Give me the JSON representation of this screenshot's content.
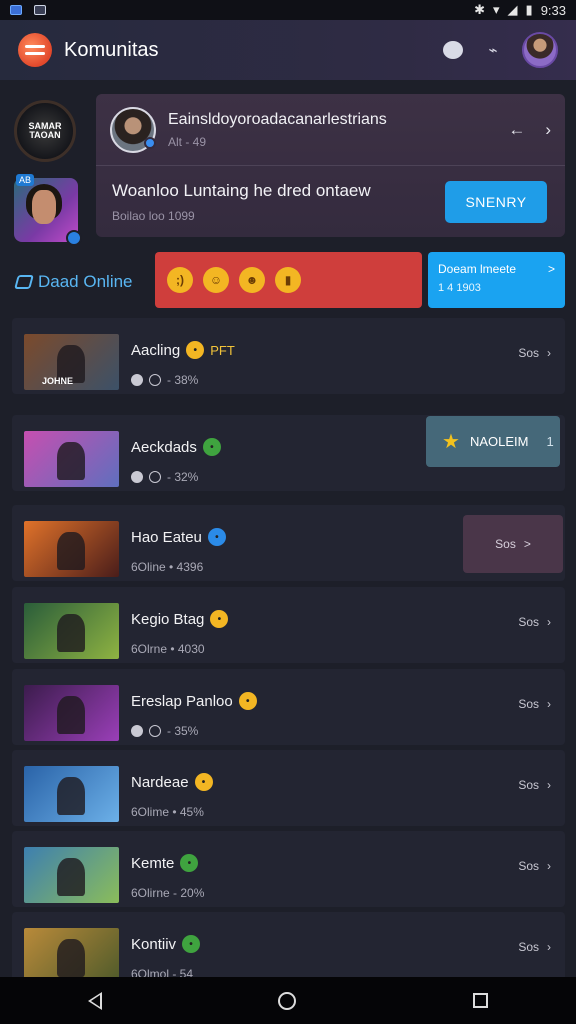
{
  "status_bar": {
    "time": "9:33"
  },
  "app_bar": {
    "title": "Komunitas"
  },
  "feature": {
    "name": "Eainsldoyoroadacanarlestrians",
    "sub": "Alt - 49",
    "message": "Woanloo Luntaing he dred ontaew",
    "message_sub": "Boilao loo 1099",
    "button": "SNENRY"
  },
  "left_avatars": {
    "top_label": "SAMAR TAOAN",
    "tag": "AB"
  },
  "online": {
    "label": "Daad Online"
  },
  "promo": {
    "title": "Doeam lmeete",
    "arrow": ">",
    "sub": "1 4 1903"
  },
  "list": [
    {
      "title": "Aacling",
      "badge": "PFT",
      "sub": "- 38%",
      "action": "Sos",
      "thumb": "JOHNE",
      "colors": [
        "#7b4a2c",
        "#3c5168"
      ],
      "emoji_color": "#f3b623"
    },
    {
      "title": "Aeckdads",
      "sub": "- 32%",
      "thumb": "",
      "colors": [
        "#c64fb0",
        "#5f6fbe"
      ],
      "emoji_color": "#3fa33f"
    },
    {
      "title": "Hao Eateu",
      "sub": "6Oline • 4396",
      "thumb": "",
      "colors": [
        "#e0722a",
        "#4a1d1a"
      ],
      "emoji_color": "#2b8be8"
    },
    {
      "title": "Kegio Btag",
      "sub": "6Olrne • 4030",
      "action": "Sos",
      "thumb": "",
      "colors": [
        "#2a5d3a",
        "#8fb342"
      ],
      "emoji_color": "#f3b623"
    },
    {
      "title": "Ereslap Panloo",
      "sub": "- 35%",
      "action": "Sos",
      "thumb": "",
      "colors": [
        "#3c1c4d",
        "#9a3fb8"
      ],
      "emoji_color": "#f3b623"
    },
    {
      "title": "Nardeae",
      "sub": "6Olime • 45%",
      "action": "Sos",
      "thumb": "",
      "colors": [
        "#2a63a8",
        "#6cb0e8"
      ],
      "emoji_color": "#f3b623"
    },
    {
      "title": "Kemte",
      "sub": "6Olirne - 20%",
      "action": "Sos",
      "thumb": "",
      "colors": [
        "#3d7fb0",
        "#8bbd5a"
      ],
      "emoji_color": "#3fa33f"
    },
    {
      "title": "Kontiiv",
      "sub": "6Olmol - 54",
      "action": "Sos",
      "thumb": "",
      "colors": [
        "#b98a3a",
        "#4e5a2a"
      ],
      "emoji_color": "#3fa33f"
    }
  ],
  "extras": {
    "star_box": {
      "label": "NAOLEIM",
      "count": "1"
    },
    "purple_box": {
      "label": "Sos",
      "arrow": ">"
    }
  }
}
